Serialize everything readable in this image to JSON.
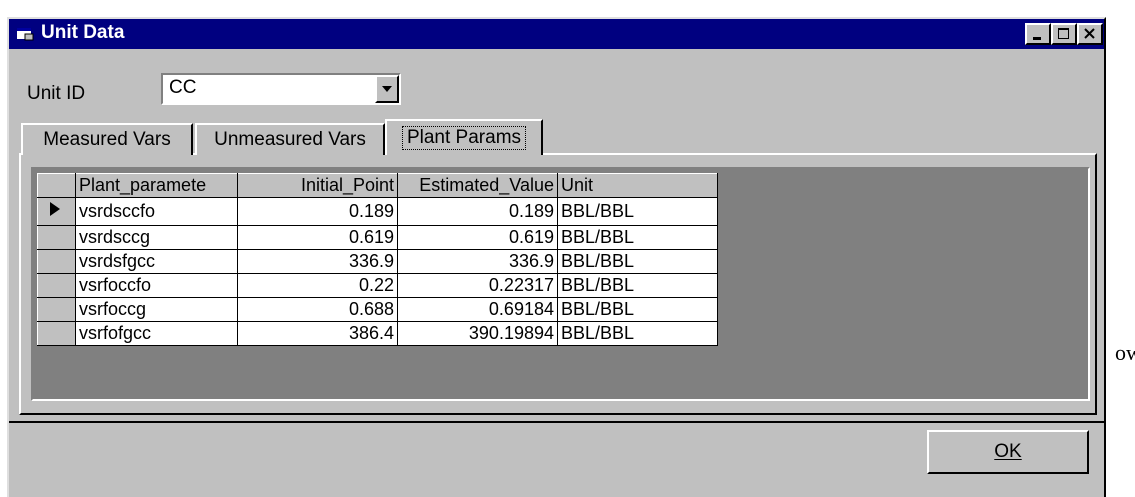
{
  "window": {
    "title": "Unit Data"
  },
  "unit_id": {
    "label": "Unit ID",
    "value": "CC"
  },
  "tabs": [
    {
      "label": "Measured Vars",
      "active": false
    },
    {
      "label": "Unmeasured Vars",
      "active": false
    },
    {
      "label": "Plant Params",
      "active": true
    }
  ],
  "grid": {
    "headers": [
      "Plant_paramete",
      "Initial_Point",
      "Estimated_Value",
      "Unit"
    ],
    "rows": [
      [
        "vsrdsccfo",
        "0.189",
        "0.189",
        "BBL/BBL"
      ],
      [
        "vsrdsccg",
        "0.619",
        "0.619",
        "BBL/BBL"
      ],
      [
        "vsrdsfgcc",
        "336.9",
        "336.9",
        "BBL/BBL"
      ],
      [
        "vsrfoccfo",
        "0.22",
        "0.22317",
        "BBL/BBL"
      ],
      [
        "vsrfoccg",
        "0.688",
        "0.69184",
        "BBL/BBL"
      ],
      [
        "vsrfofgcc",
        "386.4",
        "390.19894",
        "BBL/BBL"
      ]
    ],
    "current_row": 0
  },
  "buttons": {
    "ok": "OK"
  },
  "background_text": "ow",
  "icons": [
    "app-icon",
    "minimize-icon",
    "maximize-icon",
    "close-icon",
    "dropdown-arrow-icon",
    "row-pointer-icon"
  ],
  "colors": {
    "titlebar": "#000080",
    "face": "#c0c0c0",
    "grid_bg": "#808080"
  }
}
